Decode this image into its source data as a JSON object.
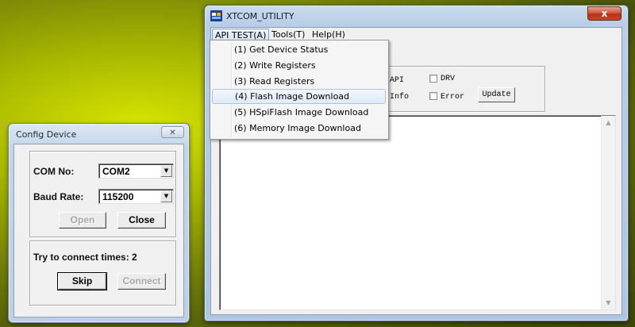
{
  "config_dialog": {
    "title": "Config Device",
    "close_glyph": "✕",
    "com_label": "COM No:",
    "com_value": "COM2",
    "baud_label": "Baud Rate:",
    "baud_value": "115200",
    "open_label": "Open",
    "close_label": "Close",
    "status_text": "Try to connect times: 2",
    "skip_label": "Skip",
    "connect_label": "Connect",
    "dropdown_glyph": "▼"
  },
  "main_window": {
    "title": "XTCOM_UTILITY",
    "close_glyph": "x",
    "menubar": [
      {
        "label": "API TEST(A)",
        "active": true
      },
      {
        "label": "Tools(T)"
      },
      {
        "label": "Help(H)"
      }
    ],
    "options": {
      "api_label": "API",
      "drv_label": "DRV",
      "info_label": "Info",
      "error_label": "Error",
      "update_label": "Update"
    },
    "scroll_up_glyph": "▲",
    "scroll_down_glyph": "▼"
  },
  "api_menu": {
    "items": [
      "(1) Get Device Status",
      "(2) Write Registers",
      "(3) Read Registers",
      "(4) Flash Image Download",
      "(5) HSpiFlash Image Download",
      "(6) Memory Image Download"
    ],
    "highlighted_index": 3
  },
  "colors": {
    "desktop": "#8fa000",
    "window_frame": "#b8cde6",
    "close_button": "#c8472b",
    "menu_highlight": "#dfebf9"
  }
}
